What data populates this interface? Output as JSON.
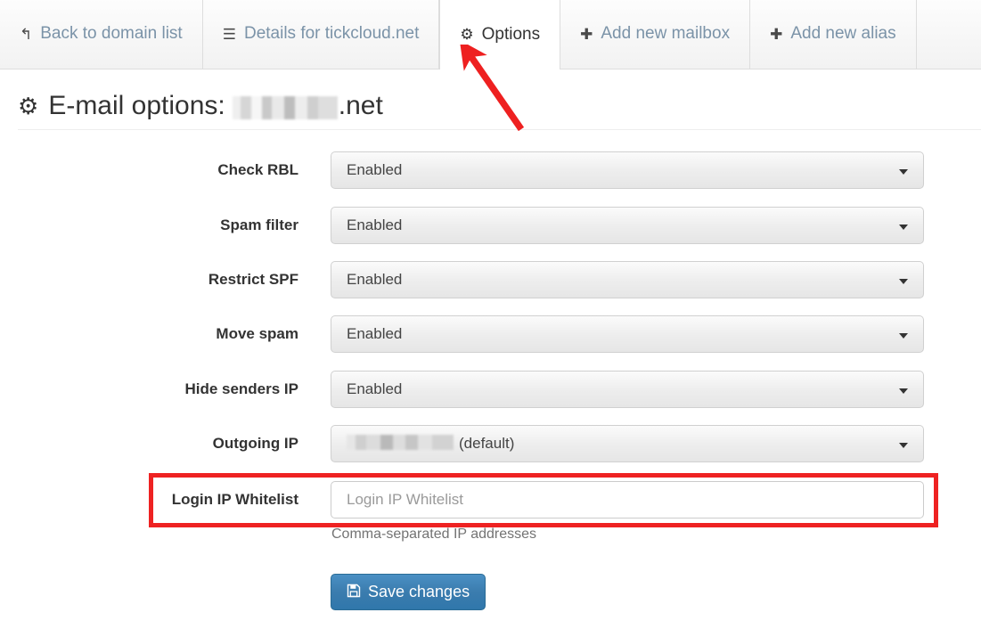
{
  "tabs": [
    {
      "label": "Back to domain list",
      "icon": "back-arrow-icon",
      "glyph": "↰",
      "active": false
    },
    {
      "label": "Details for tickcloud.net",
      "icon": "list-icon",
      "glyph": "☰",
      "active": false
    },
    {
      "label": "Options",
      "icon": "gear-icon",
      "glyph": "⚙",
      "active": true
    },
    {
      "label": "Add new mailbox",
      "icon": "plus-icon",
      "glyph": "✚",
      "active": false
    },
    {
      "label": "Add new alias",
      "icon": "plus-icon",
      "glyph": "✚",
      "active": false
    }
  ],
  "page": {
    "title_prefix": "E-mail options:",
    "title_icon": "gear-icon",
    "title_glyph": "⚙",
    "domain_suffix": ".net",
    "domain_redacted": true
  },
  "form": {
    "rows": [
      {
        "label": "Check RBL",
        "value": "Enabled",
        "type": "select"
      },
      {
        "label": "Spam filter",
        "value": "Enabled",
        "type": "select"
      },
      {
        "label": "Restrict SPF",
        "value": "Enabled",
        "type": "select"
      },
      {
        "label": "Move spam",
        "value": "Enabled",
        "type": "select"
      },
      {
        "label": "Hide senders IP",
        "value": "Enabled",
        "type": "select"
      },
      {
        "label": "Outgoing IP",
        "value": "(default)",
        "type": "select-redacted"
      }
    ],
    "whitelist": {
      "label": "Login IP Whitelist",
      "value": "",
      "placeholder": "Login IP Whitelist",
      "help": "Comma-separated IP addresses",
      "highlighted": true
    },
    "save": {
      "label": "Save changes",
      "icon": "save-floppy-icon",
      "glyph": "💾"
    }
  },
  "annotation": {
    "type": "arrow",
    "color": "#ee2020",
    "points_to": "Options"
  },
  "colors": {
    "highlight": "#ee2222",
    "arrow": "#ee2020",
    "button_primary": "#3b7cae",
    "tab_inactive_text": "#7b93a8",
    "label_text": "#333333",
    "help_text": "#737373"
  }
}
